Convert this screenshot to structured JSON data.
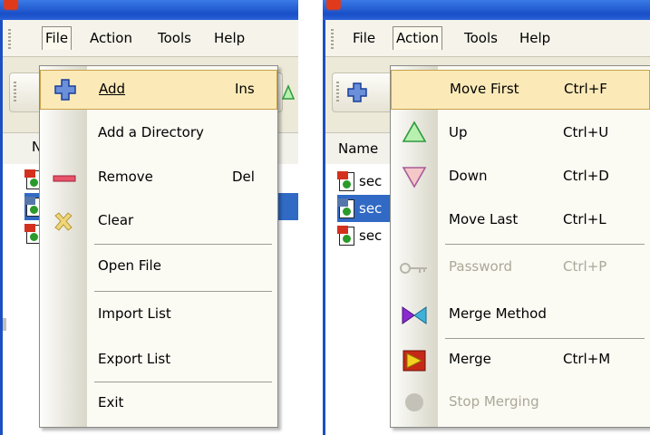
{
  "left_window": {
    "menubar": [
      "File",
      "Action",
      "Tools",
      "Help"
    ],
    "list_header": "Name",
    "file_menu": {
      "items": [
        {
          "label": "Add",
          "shortcut": "Ins"
        },
        {
          "label": "Add a Directory",
          "shortcut": ""
        },
        {
          "label": "Remove",
          "shortcut": "Del"
        },
        {
          "label": "Clear",
          "shortcut": ""
        },
        {
          "label": "Open File",
          "shortcut": ""
        },
        {
          "label": "Import List",
          "shortcut": ""
        },
        {
          "label": "Export List",
          "shortcut": ""
        },
        {
          "label": "Exit",
          "shortcut": ""
        }
      ]
    }
  },
  "right_window": {
    "menubar": [
      "File",
      "Action",
      "Tools",
      "Help"
    ],
    "list_header": "Name",
    "list_rows": [
      "sec",
      "sec",
      "sec"
    ],
    "action_menu": {
      "items": [
        {
          "label": "Move First",
          "shortcut": "Ctrl+F"
        },
        {
          "label": "Up",
          "shortcut": "Ctrl+U"
        },
        {
          "label": "Down",
          "shortcut": "Ctrl+D"
        },
        {
          "label": "Move Last",
          "shortcut": "Ctrl+L"
        },
        {
          "label": "Password",
          "shortcut": "Ctrl+P"
        },
        {
          "label": "Merge Method",
          "shortcut": ""
        },
        {
          "label": "Merge",
          "shortcut": "Ctrl+M"
        },
        {
          "label": "Stop Merging",
          "shortcut": ""
        }
      ]
    }
  },
  "colors": {
    "menu_highlight": "#fbeab8",
    "selection": "#316ac5",
    "titlebar": "#1a4fc7",
    "disabled_text": "#aca899"
  }
}
